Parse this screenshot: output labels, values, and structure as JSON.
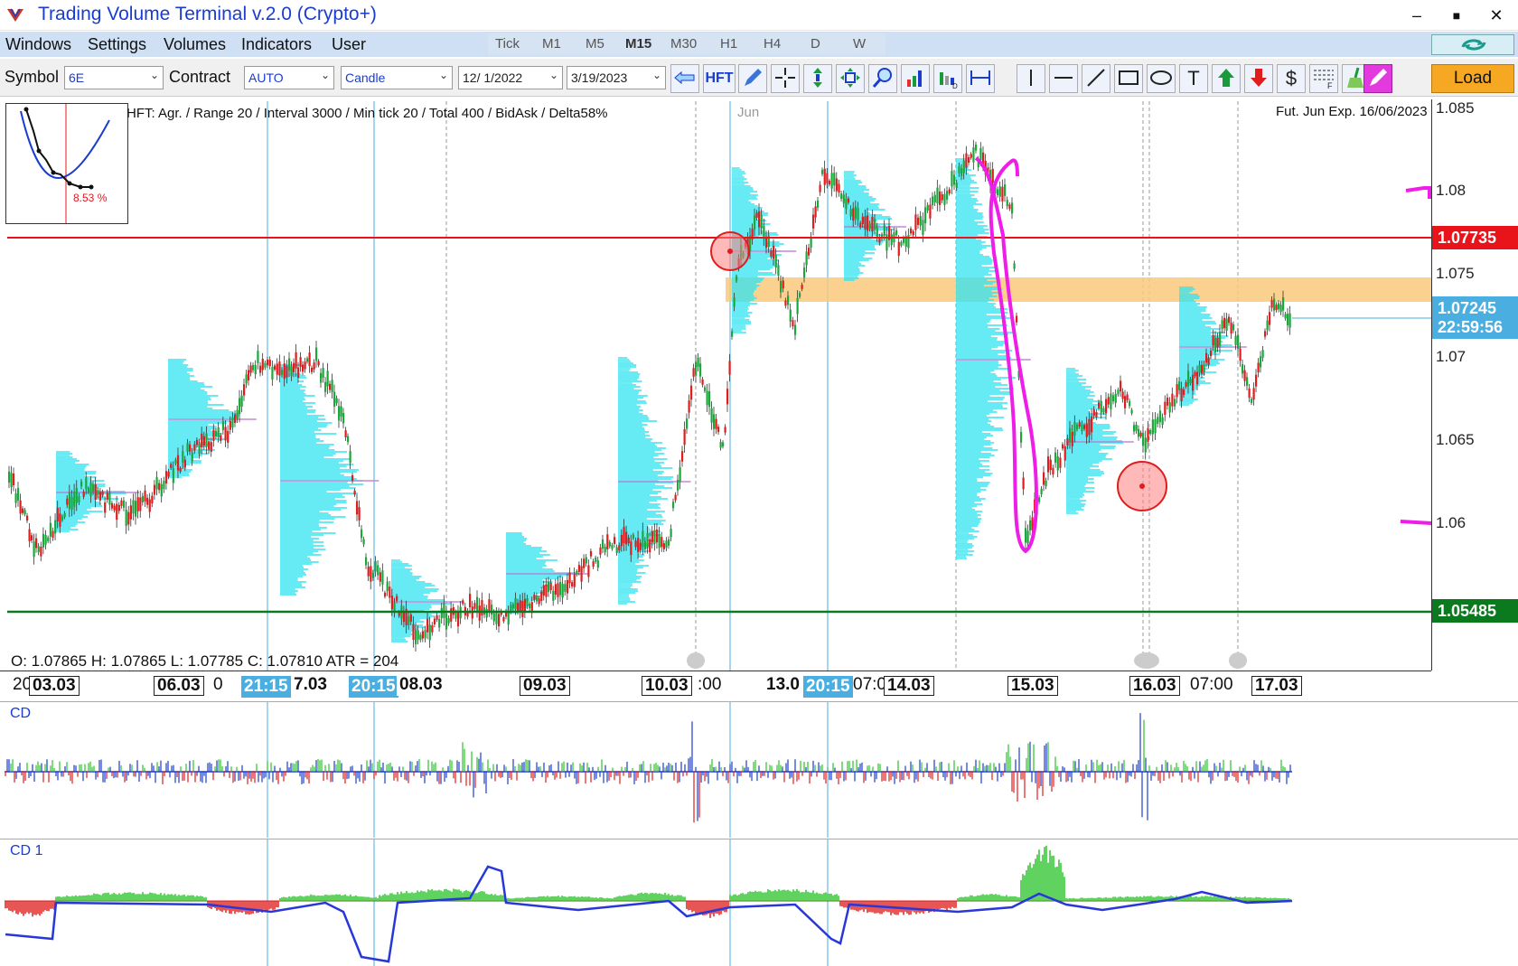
{
  "window": {
    "title": "Trading Volume Terminal v.2.0 (Crypto+)",
    "minimize": "–",
    "maximize": "■",
    "close": "✕"
  },
  "menu": {
    "items": [
      "Windows",
      "Settings",
      "Volumes",
      "Indicators",
      "User"
    ]
  },
  "timeframes": {
    "items": [
      "Tick",
      "M1",
      "M5",
      "M15",
      "M30",
      "H1",
      "H4",
      "D",
      "W"
    ],
    "active": "M15"
  },
  "toolbar": {
    "symbol_label": "Symbol",
    "symbol_value": "6E",
    "contract_label": "Contract",
    "contract_value": "AUTO",
    "chart_type": "Candle",
    "date_from": "12/ 1/2022",
    "date_to": "3/19/2023",
    "hft_label": "HFT",
    "text_tool": "T",
    "dollar_tool": "$",
    "load_label": "Load"
  },
  "chart": {
    "info_line": "HFT: Agr. / Range 20 / Interval 3000 / Min tick 20 / Total 400 / BidAsk / Delta58%",
    "expiry": "Fut. Jun Exp. 16/06/2023",
    "month_marker": "Jun",
    "ohlc": "O: 1.07865   H: 1.07865   L: 1.07785   C: 1.07810   ATR = 204",
    "mini_pct": "8.53 %",
    "price_ticks": [
      "1.085",
      "1.08",
      "1.075",
      "1.07",
      "1.065",
      "1.06"
    ],
    "badges": {
      "resistance": "1.07735",
      "current": "1.07245",
      "countdown": "22:59:56",
      "support": "1.05485"
    },
    "colors": {
      "resistance": "#e8141a",
      "support": "#0b7a1e",
      "current": "#4aaee0",
      "profile": "#33e3f0",
      "zone": "#f9c97a",
      "annotation": "#ee1ee8"
    },
    "time_axis": {
      "lead": "20",
      "dates": [
        "03.03",
        "06.03",
        "7.03",
        "08.03",
        "09.03",
        "10.03",
        "13.0",
        "14.03",
        "15.03",
        "16.03",
        "17.03"
      ],
      "plain": [
        "0",
        ":00",
        "07:0",
        "07:00"
      ],
      "highlights": [
        "21:15",
        "20:15",
        "20:15"
      ]
    }
  },
  "panes": {
    "cd": "CD",
    "cd1": "CD 1"
  }
}
